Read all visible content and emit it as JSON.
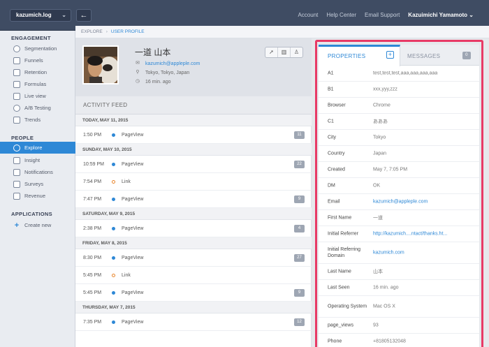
{
  "topbar": {
    "app_name": "kazumich.log",
    "links": [
      "Account",
      "Help Center",
      "Email Support"
    ],
    "user": "Kazuimichi Yamamoto"
  },
  "breadcrumb": {
    "root": "EXPLORE",
    "current": "USER PROFILE"
  },
  "sidebar": {
    "engagement_heading": "ENGAGEMENT",
    "engagement": [
      "Segmentation",
      "Funnels",
      "Retention",
      "Formulas",
      "Live view",
      "A/B Testing",
      "Trends"
    ],
    "people_heading": "PEOPLE",
    "people": [
      "Explore",
      "Insight",
      "Notifications",
      "Surveys",
      "Revenue"
    ],
    "applications_heading": "APPLICATIONS",
    "create_new": "Create new"
  },
  "profile": {
    "name": "一道 山本",
    "email": "kazumich@appleple.com",
    "location": "Tokyo, Tokyo, Japan",
    "last_seen": "16 min. ago"
  },
  "feed": {
    "heading": "ACTIVITY FEED",
    "groups": [
      {
        "date": "TODAY, MAY 11, 2015",
        "events": [
          {
            "time": "1:50 PM",
            "name": "PageView",
            "type": "dot",
            "count": "11"
          }
        ]
      },
      {
        "date": "SUNDAY, MAY 10, 2015",
        "events": [
          {
            "time": "10:59 PM",
            "name": "PageView",
            "type": "dot",
            "count": "22"
          },
          {
            "time": "7:54 PM",
            "name": "Link",
            "type": "ring",
            "count": ""
          },
          {
            "time": "7:47 PM",
            "name": "PageView",
            "type": "dot",
            "count": "9"
          }
        ]
      },
      {
        "date": "SATURDAY, MAY 9, 2015",
        "events": [
          {
            "time": "2:38 PM",
            "name": "PageView",
            "type": "dot",
            "count": "4"
          }
        ]
      },
      {
        "date": "FRIDAY, MAY 8, 2015",
        "events": [
          {
            "time": "8:30 PM",
            "name": "PageView",
            "type": "dot",
            "count": "27"
          },
          {
            "time": "5:45 PM",
            "name": "Link",
            "type": "ring",
            "count": ""
          },
          {
            "time": "5:45 PM",
            "name": "PageView",
            "type": "dot",
            "count": "9"
          }
        ]
      },
      {
        "date": "THURSDAY, MAY 7, 2015",
        "events": [
          {
            "time": "7:35 PM",
            "name": "PageView",
            "type": "dot",
            "count": "12"
          }
        ]
      }
    ]
  },
  "panel": {
    "tab_properties": "PROPERTIES",
    "tab_messages": "MESSAGES",
    "messages_count": "0",
    "properties": [
      {
        "key": "A1",
        "value": "test,test,test,aaa,aaa,aaa,aaa",
        "link": false
      },
      {
        "key": "B1",
        "value": "xxx,yyy,zzz",
        "link": false
      },
      {
        "key": "Browser",
        "value": "Chrome",
        "link": false
      },
      {
        "key": "C1",
        "value": "あああ",
        "link": false
      },
      {
        "key": "City",
        "value": "Tokyo",
        "link": false
      },
      {
        "key": "Country",
        "value": "Japan",
        "link": false
      },
      {
        "key": "Created",
        "value": "May 7, 7:05 PM",
        "link": false
      },
      {
        "key": "DM",
        "value": "OK",
        "link": false
      },
      {
        "key": "Email",
        "value": "kazumich@appleple.com",
        "link": true
      },
      {
        "key": "First Name",
        "value": "一道",
        "link": false
      },
      {
        "key": "Initial Referrer",
        "value": "http://kazumich....ntact/thanks.ht...",
        "link": true
      },
      {
        "key": "Initial Referring Domain",
        "value": "kazumich.com",
        "link": true
      },
      {
        "key": "Last Name",
        "value": "山本",
        "link": false
      },
      {
        "key": "Last Seen",
        "value": "16 min. ago",
        "link": false
      },
      {
        "key": "Operating System",
        "value": "Mac OS X",
        "link": false
      },
      {
        "key": "page_views",
        "value": "93",
        "link": false
      },
      {
        "key": "Phone",
        "value": "+81805132048",
        "link": false
      }
    ]
  }
}
